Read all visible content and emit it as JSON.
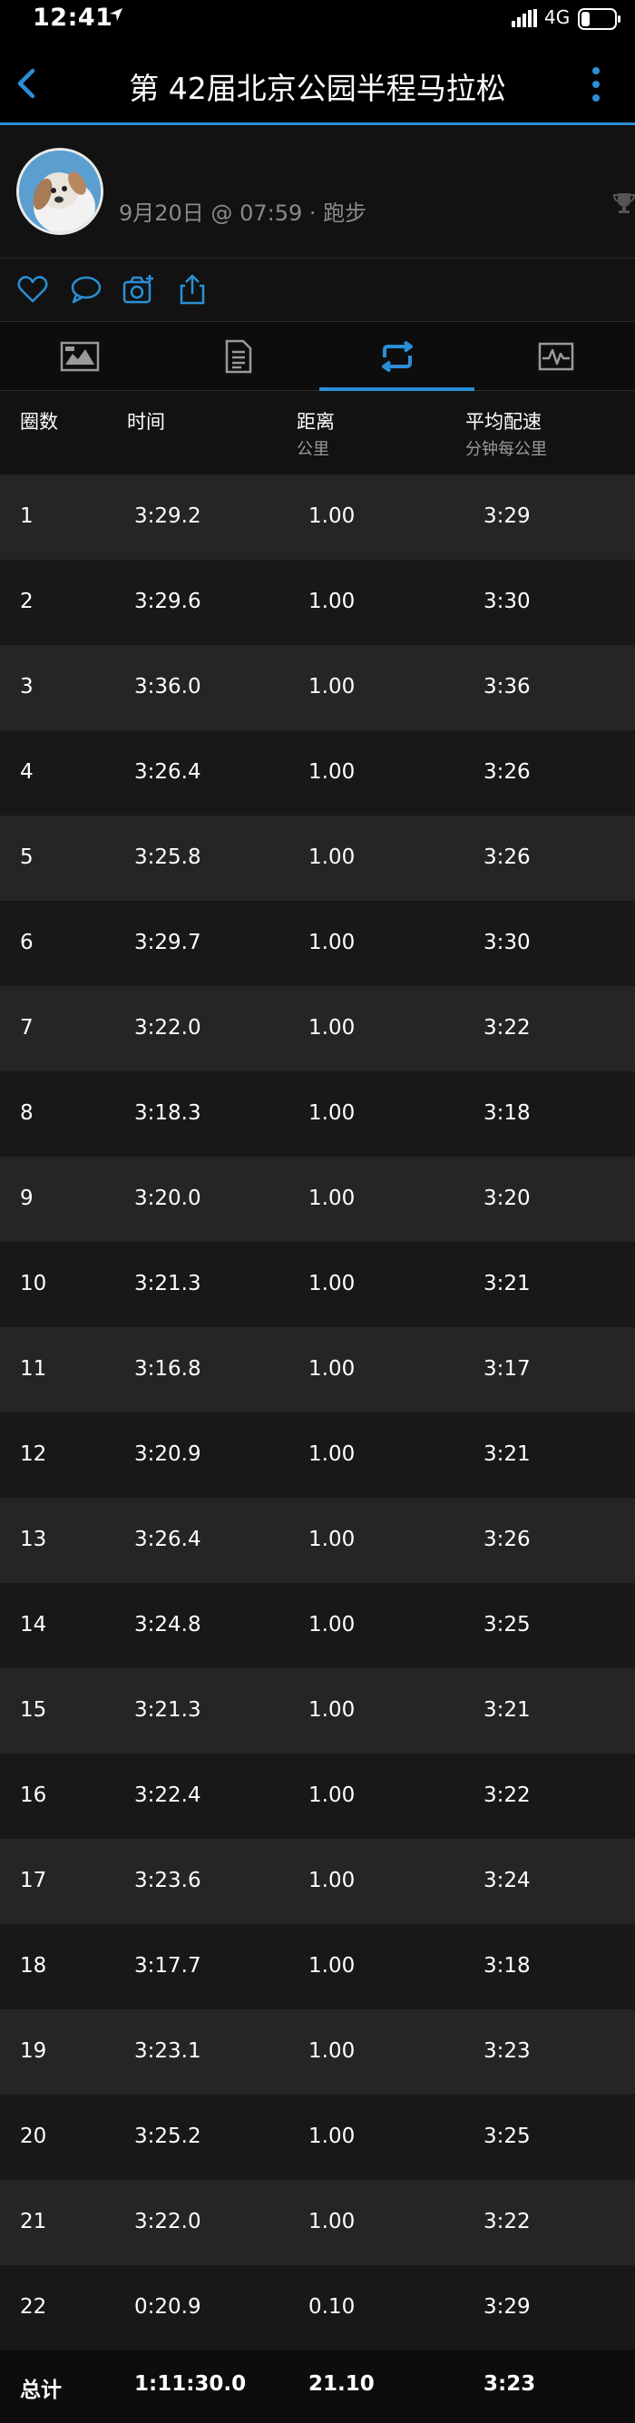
{
  "status_bar": {
    "time": "12:41",
    "network": "4G"
  },
  "header": {
    "title": "第 42届北京公园半程马拉松"
  },
  "activity": {
    "meta": "9月20日 @ 07:59 · 跑步"
  },
  "tabs": [
    {
      "name": "overview",
      "icon": "chart-image-icon"
    },
    {
      "name": "details",
      "icon": "document-icon"
    },
    {
      "name": "laps",
      "icon": "loop-arrow-icon",
      "active": true
    },
    {
      "name": "charts",
      "icon": "activity-graph-icon"
    }
  ],
  "table": {
    "headers": {
      "lap": "圈数",
      "time": "时间",
      "distance": "距离",
      "distance_unit": "公里",
      "pace": "平均配速",
      "pace_unit": "分钟每公里"
    },
    "rows": [
      {
        "lap": "1",
        "time": "3:29.2",
        "distance": "1.00",
        "pace": "3:29"
      },
      {
        "lap": "2",
        "time": "3:29.6",
        "distance": "1.00",
        "pace": "3:30"
      },
      {
        "lap": "3",
        "time": "3:36.0",
        "distance": "1.00",
        "pace": "3:36"
      },
      {
        "lap": "4",
        "time": "3:26.4",
        "distance": "1.00",
        "pace": "3:26"
      },
      {
        "lap": "5",
        "time": "3:25.8",
        "distance": "1.00",
        "pace": "3:26"
      },
      {
        "lap": "6",
        "time": "3:29.7",
        "distance": "1.00",
        "pace": "3:30"
      },
      {
        "lap": "7",
        "time": "3:22.0",
        "distance": "1.00",
        "pace": "3:22"
      },
      {
        "lap": "8",
        "time": "3:18.3",
        "distance": "1.00",
        "pace": "3:18"
      },
      {
        "lap": "9",
        "time": "3:20.0",
        "distance": "1.00",
        "pace": "3:20"
      },
      {
        "lap": "10",
        "time": "3:21.3",
        "distance": "1.00",
        "pace": "3:21"
      },
      {
        "lap": "11",
        "time": "3:16.8",
        "distance": "1.00",
        "pace": "3:17"
      },
      {
        "lap": "12",
        "time": "3:20.9",
        "distance": "1.00",
        "pace": "3:21"
      },
      {
        "lap": "13",
        "time": "3:26.4",
        "distance": "1.00",
        "pace": "3:26"
      },
      {
        "lap": "14",
        "time": "3:24.8",
        "distance": "1.00",
        "pace": "3:25"
      },
      {
        "lap": "15",
        "time": "3:21.3",
        "distance": "1.00",
        "pace": "3:21"
      },
      {
        "lap": "16",
        "time": "3:22.4",
        "distance": "1.00",
        "pace": "3:22"
      },
      {
        "lap": "17",
        "time": "3:23.6",
        "distance": "1.00",
        "pace": "3:24"
      },
      {
        "lap": "18",
        "time": "3:17.7",
        "distance": "1.00",
        "pace": "3:18"
      },
      {
        "lap": "19",
        "time": "3:23.1",
        "distance": "1.00",
        "pace": "3:23"
      },
      {
        "lap": "20",
        "time": "3:25.2",
        "distance": "1.00",
        "pace": "3:25"
      },
      {
        "lap": "21",
        "time": "3:22.0",
        "distance": "1.00",
        "pace": "3:22"
      },
      {
        "lap": "22",
        "time": "0:20.9",
        "distance": "0.10",
        "pace": "3:29"
      }
    ],
    "total": {
      "label": "总计",
      "time": "1:11:30.0",
      "distance": "21.10",
      "pace": "3:23"
    }
  },
  "colors": {
    "accent": "#2a8fd6",
    "background": "#111111",
    "row_alt": "#252525"
  }
}
